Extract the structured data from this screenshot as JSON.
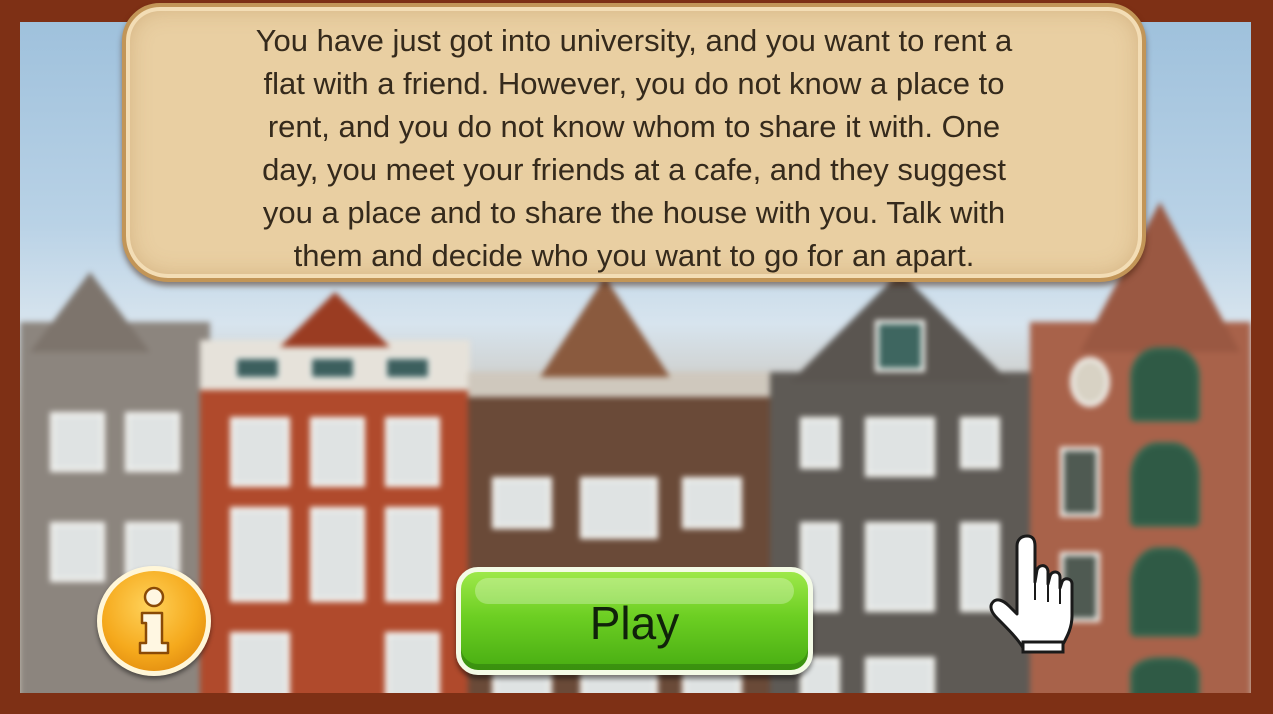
{
  "story": {
    "lines": [
      "You have just got into university, and you want to rent a",
      "flat with a friend. However, you do not know a place to",
      "rent, and you do not know whom to share it with. One",
      "day, you meet your friends at a cafe, and they suggest",
      "you a place and to share the house with you. Talk with",
      "them and decide who you want to go for an apart."
    ]
  },
  "buttons": {
    "play_label": "Play",
    "info_icon": "info-icon"
  },
  "colors": {
    "frame": "#7e3015",
    "panel": "#e9cfa2",
    "play_green": "#6dcf23",
    "info_orange": "#f5a91c"
  }
}
